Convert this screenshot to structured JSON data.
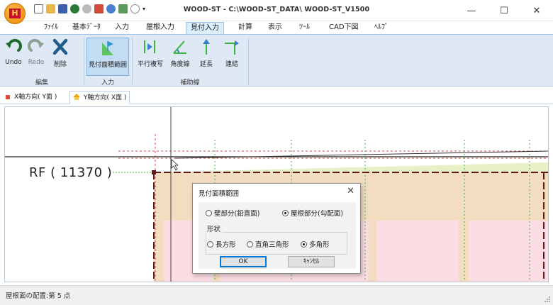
{
  "window": {
    "title": "WOOD-ST - C:\\WOOD-ST_DATA\\ WOOD-ST_V1500",
    "minimize_glyph": "—",
    "maximize_glyph": "☐",
    "close_glyph": "✕",
    "logo_letter": "H"
  },
  "menu": {
    "tabs": [
      {
        "label": "ﾌｧｲﾙ"
      },
      {
        "label": "基本ﾃﾞｰﾀ"
      },
      {
        "label": "入力"
      },
      {
        "label": "屋根入力"
      },
      {
        "label": "見付入力"
      },
      {
        "label": "計算"
      },
      {
        "label": "表示"
      },
      {
        "label": "ﾂｰﾙ"
      },
      {
        "label": "CAD下図"
      },
      {
        "label": "ﾍﾙﾌﾟ"
      }
    ],
    "active_index": 4
  },
  "ribbon": {
    "buttons": {
      "undo": "Undo",
      "redo": "Redo",
      "delete": "削除",
      "area": "見付面積範囲",
      "parallel_copy": "平行複写",
      "angle_line": "角度線",
      "extend": "延長",
      "connect": "連結"
    },
    "groups": {
      "edit": "編集",
      "input": "入力",
      "aux": "補助線"
    },
    "icons": {
      "undo": "undo-arrow-icon",
      "redo": "redo-arrow-icon",
      "delete": "delete-x-icon",
      "area": "area-flag-icon",
      "parallel_copy": "parallel-copy-icon",
      "angle_line": "angle-line-icon",
      "extend": "extend-line-icon",
      "connect": "connect-line-icon"
    }
  },
  "doc_tabs": [
    {
      "label": "X軸方向( Y面 )"
    },
    {
      "label": "Y軸方向( X面 )"
    }
  ],
  "canvas": {
    "level_label": "RF ( 11370 )"
  },
  "dialog": {
    "title": "見付面積範囲",
    "close_glyph": "✕",
    "part_options": [
      {
        "label": "壁部分(鉛直面)",
        "selected": false
      },
      {
        "label": "屋根部分(勾配面)",
        "selected": true
      }
    ],
    "shape_legend": "形状",
    "shape_options": [
      {
        "label": "長方形",
        "selected": false
      },
      {
        "label": "直角三角形",
        "selected": false
      },
      {
        "label": "多角形",
        "selected": true
      }
    ],
    "ok_label": "OK",
    "cancel_label": "ｷｬﾝｾﾙ"
  },
  "status": {
    "text": "屋根面の配置:第 5 点"
  },
  "colors": {
    "accent": "#0078d7",
    "ribbon_bg": "#dfe9f5",
    "wall_fill": "#f2ddc0",
    "roof_fill": "#e9f0c8",
    "panel_pink": "#fbdde3",
    "guide_red": "#e8483a",
    "guide_green": "#3cb43c"
  }
}
